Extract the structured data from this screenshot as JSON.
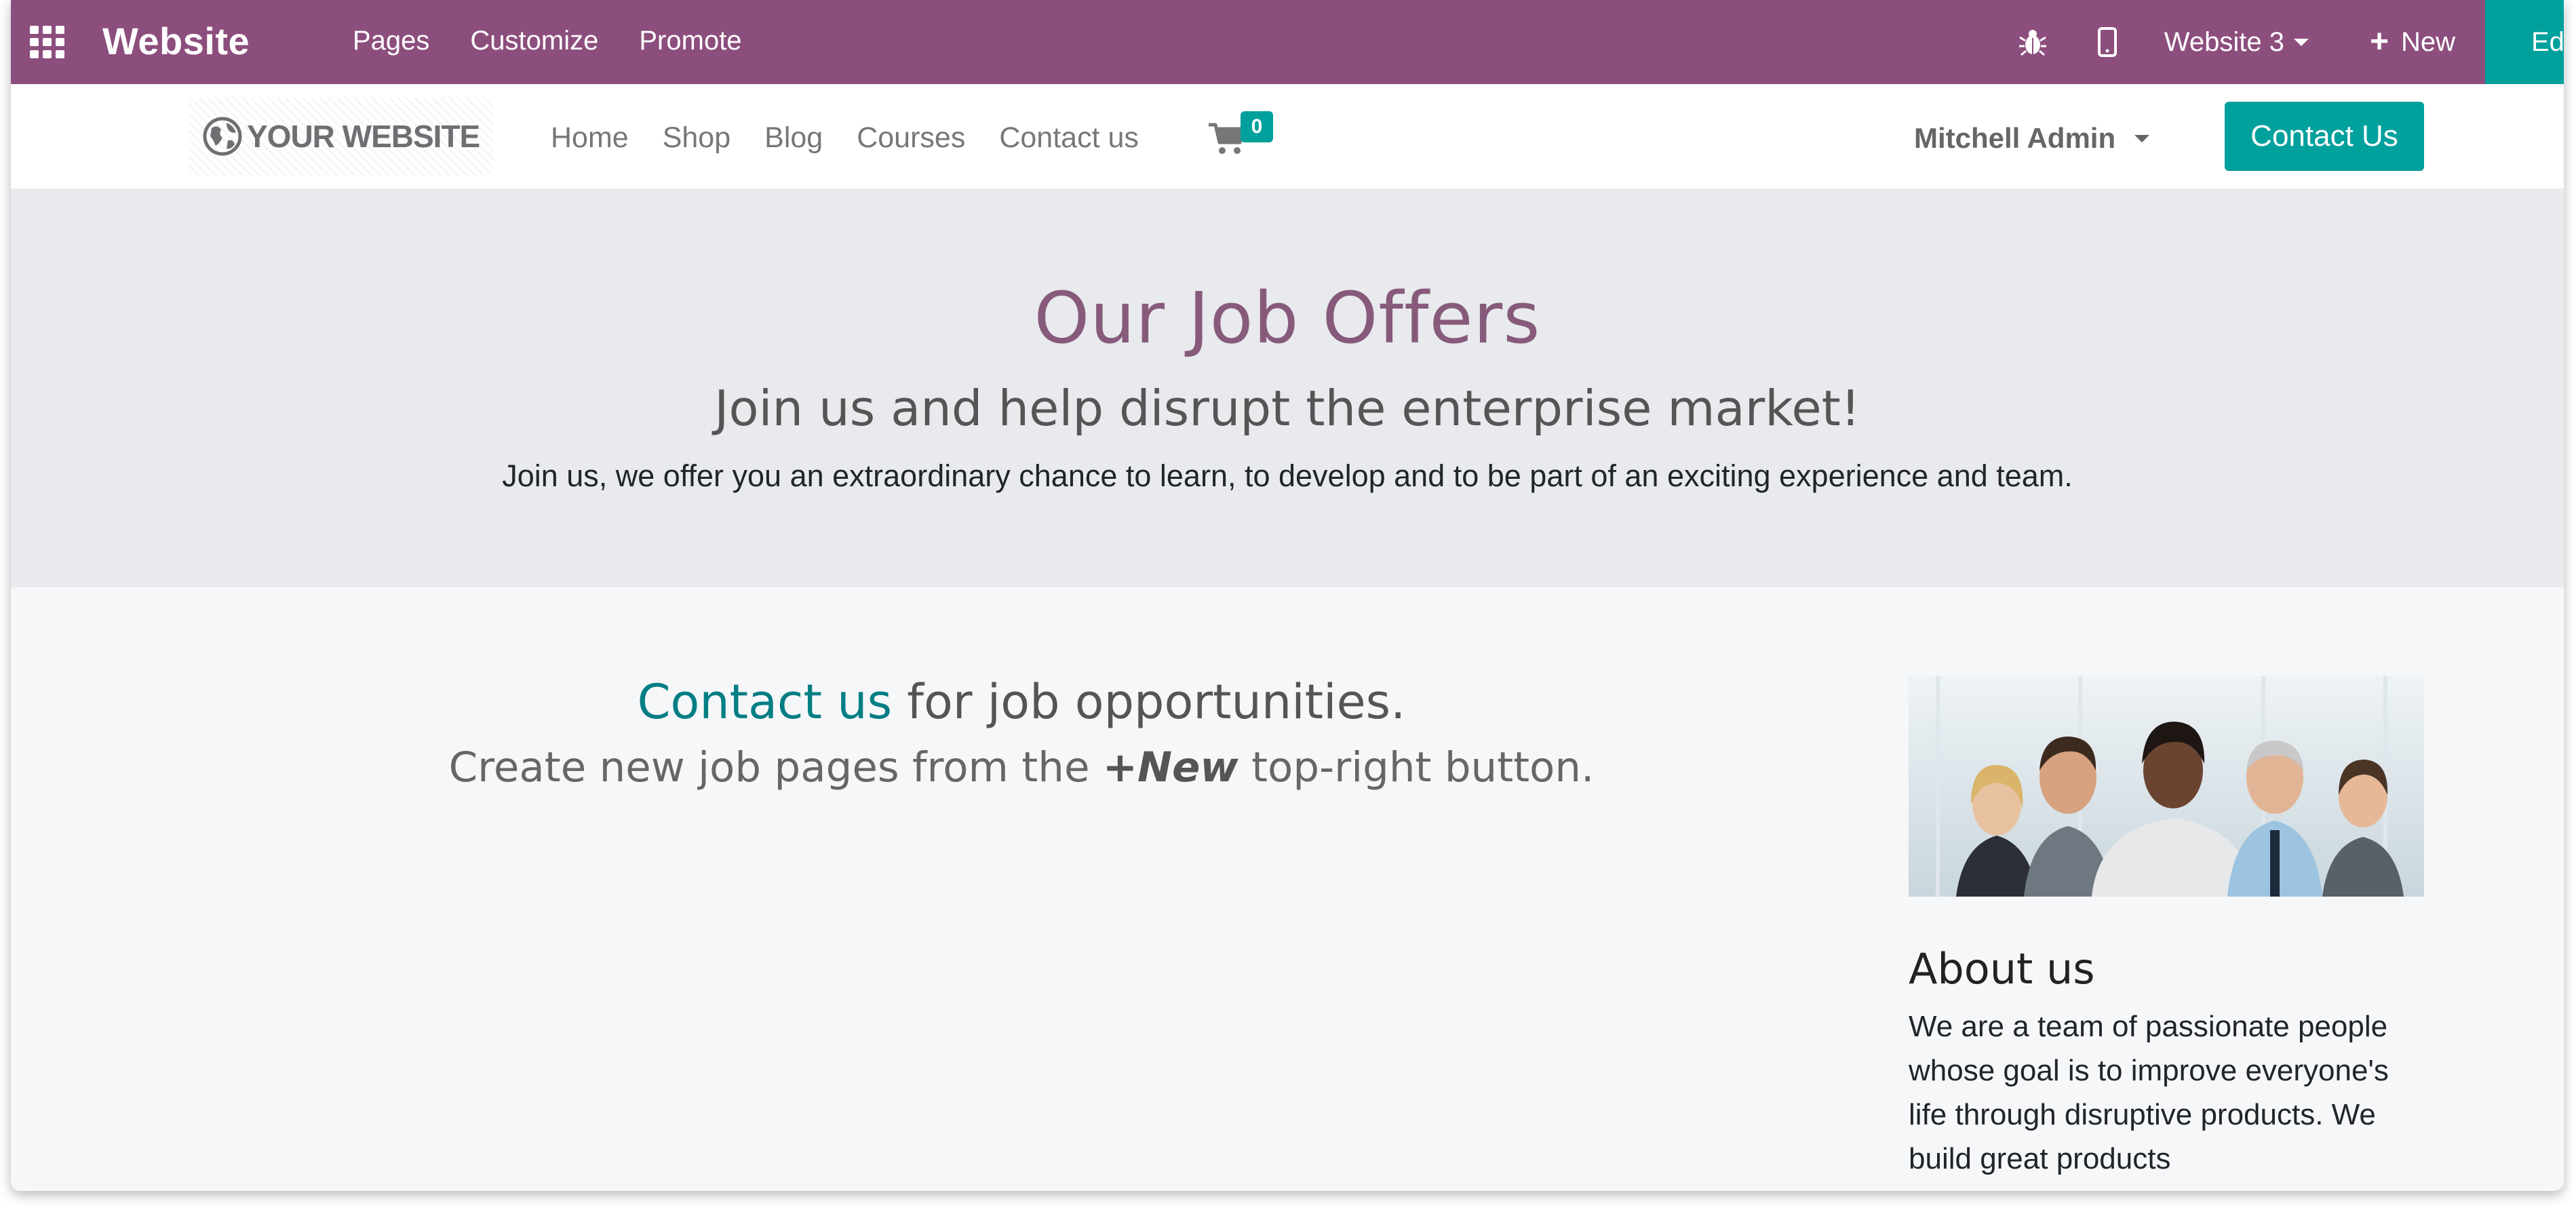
{
  "admin_bar": {
    "app_name": "Website",
    "menu": [
      "Pages",
      "Customize",
      "Promote"
    ],
    "website_selector": "Website 3",
    "new_label": "New",
    "edit_label": "Edit",
    "background_color": "#8c4e7d",
    "edit_color": "#00a09d"
  },
  "site_header": {
    "logo_text": "YOUR WEBSITE",
    "nav": [
      "Home",
      "Shop",
      "Blog",
      "Courses",
      "Contact us"
    ],
    "cart_count": "0",
    "user_name": "Mitchell Admin",
    "contact_button": "Contact Us"
  },
  "hero": {
    "title": "Our Job Offers",
    "subtitle": "Join us and help disrupt the enterprise market!",
    "text": "Join us, we offer you an extraordinary chance to learn, to develop and to be part of an exciting experience and team."
  },
  "content": {
    "cta_link": "Contact us",
    "cta_rest": " for job opportunities.",
    "sub_pre": "Create new job pages from the ",
    "sub_bold": "+New",
    "sub_post": " top-right button."
  },
  "about": {
    "title": "About us",
    "text": "We are a team of passionate people whose goal is to improve everyone's life through disruptive products. We build great products"
  }
}
